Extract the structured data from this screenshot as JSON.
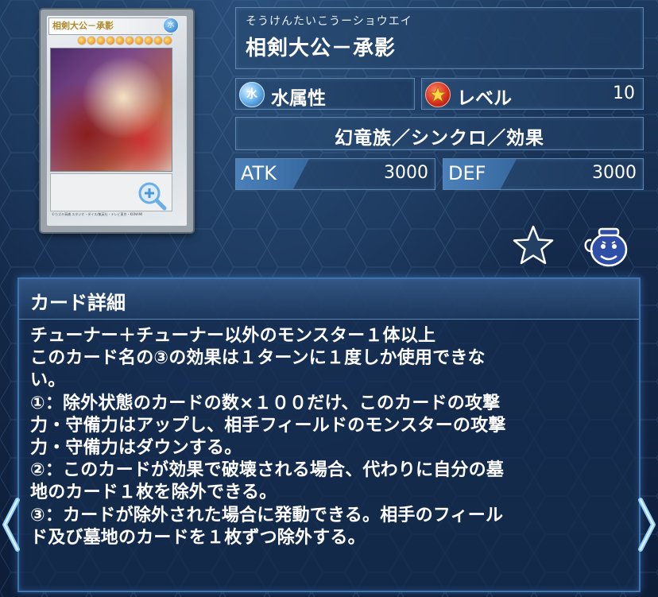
{
  "card": {
    "reading": "そうけんたいこうーショウエイ",
    "name": "相剣大公－承影",
    "image_name_text": "相剣大公－承影",
    "image_attribute_glyph": "水",
    "attribute_icon": "water-attribute-icon",
    "attribute_glyph": "水",
    "attribute_label": "水属性",
    "level_icon": "level-star-icon",
    "level_label": "レベル",
    "level_value": "10",
    "type_line": "幻竜族／シンクロ／効果",
    "atk_label": "ATK",
    "atk_value": "3000",
    "def_label": "DEF",
    "def_value": "3000",
    "copyright": "©カズキ高橋 スタジオ・ダイス/集英社・テレビ東京・KONAMI"
  },
  "actions": {
    "zoom_icon": "zoom-in-icon",
    "favorite_icon": "star-icon",
    "deck_icon": "pot-of-greed-icon"
  },
  "detail": {
    "title": "カード詳細",
    "lines": [
      "チューナー＋チューナー以外のモンスター１体以上",
      "このカード名の③の効果は１ターンに１度しか使用できな",
      "い。",
      "①：除外状態のカードの数×１００だけ、このカードの攻撃",
      "力・守備力はアップし、相手フィールドのモンスターの攻撃",
      "力・守備力はダウンする。",
      "②：このカードが効果で破壊される場合、代わりに自分の墓",
      "地のカード１枚を除外できる。",
      "③：カードが除外された場合に発動できる。相手のフィール",
      "ド及び墓地のカードを１枚ずつ除外する。"
    ]
  },
  "nav": {
    "prev_icon": "chevron-left-icon",
    "next_icon": "chevron-right-icon"
  },
  "colors": {
    "background": "#14294a",
    "panel": "#284b73",
    "panel_border": "#5d86b0",
    "stat_tag": "#4b80b8",
    "text": "#ffffff"
  }
}
